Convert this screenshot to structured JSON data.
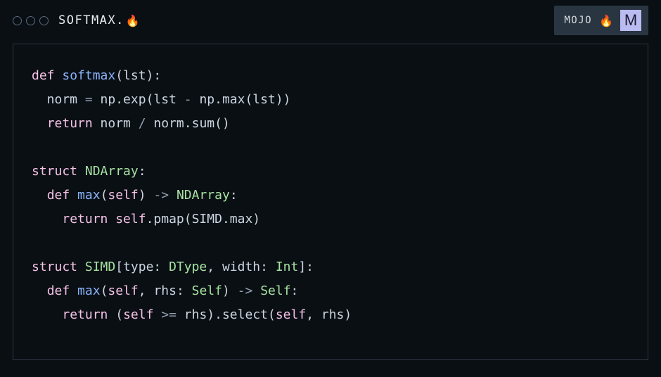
{
  "titlebar": {
    "filename_base": "SOFTMAX.",
    "fire_icon": "🔥",
    "lang_label": "MOJO",
    "lang_icon_letter": "M"
  },
  "code": {
    "lines": [
      [
        {
          "cls": "tok-kw",
          "t": "def "
        },
        {
          "cls": "tok-fn",
          "t": "softmax"
        },
        {
          "cls": "tok-paren",
          "t": "(lst):"
        }
      ],
      [
        {
          "cls": "tok-text",
          "t": "  norm "
        },
        {
          "cls": "tok-op",
          "t": "= "
        },
        {
          "cls": "tok-text",
          "t": "np.exp(lst "
        },
        {
          "cls": "tok-op",
          "t": "- "
        },
        {
          "cls": "tok-text",
          "t": "np.max(lst))"
        }
      ],
      [
        {
          "cls": "tok-text",
          "t": "  "
        },
        {
          "cls": "tok-kw",
          "t": "return "
        },
        {
          "cls": "tok-text",
          "t": "norm "
        },
        {
          "cls": "tok-op",
          "t": "/ "
        },
        {
          "cls": "tok-text",
          "t": "norm.sum()"
        }
      ],
      [],
      [
        {
          "cls": "tok-kw",
          "t": "struct "
        },
        {
          "cls": "tok-type",
          "t": "NDArray"
        },
        {
          "cls": "tok-paren",
          "t": ":"
        }
      ],
      [
        {
          "cls": "tok-text",
          "t": "  "
        },
        {
          "cls": "tok-kw",
          "t": "def "
        },
        {
          "cls": "tok-fn",
          "t": "max"
        },
        {
          "cls": "tok-paren",
          "t": "("
        },
        {
          "cls": "tok-kw",
          "t": "self"
        },
        {
          "cls": "tok-paren",
          "t": ") "
        },
        {
          "cls": "tok-op",
          "t": "-> "
        },
        {
          "cls": "tok-type",
          "t": "NDArray"
        },
        {
          "cls": "tok-paren",
          "t": ":"
        }
      ],
      [
        {
          "cls": "tok-text",
          "t": "    "
        },
        {
          "cls": "tok-kw",
          "t": "return "
        },
        {
          "cls": "tok-kw",
          "t": "self"
        },
        {
          "cls": "tok-text",
          "t": ".pmap(SIMD.max)"
        }
      ],
      [],
      [
        {
          "cls": "tok-kw",
          "t": "struct "
        },
        {
          "cls": "tok-type",
          "t": "SIMD"
        },
        {
          "cls": "tok-paren",
          "t": "[type: "
        },
        {
          "cls": "tok-type",
          "t": "DType"
        },
        {
          "cls": "tok-paren",
          "t": ", width: "
        },
        {
          "cls": "tok-type",
          "t": "Int"
        },
        {
          "cls": "tok-paren",
          "t": "]:"
        }
      ],
      [
        {
          "cls": "tok-text",
          "t": "  "
        },
        {
          "cls": "tok-kw",
          "t": "def "
        },
        {
          "cls": "tok-fn",
          "t": "max"
        },
        {
          "cls": "tok-paren",
          "t": "("
        },
        {
          "cls": "tok-kw",
          "t": "self"
        },
        {
          "cls": "tok-paren",
          "t": ", rhs: "
        },
        {
          "cls": "tok-type",
          "t": "Self"
        },
        {
          "cls": "tok-paren",
          "t": ") "
        },
        {
          "cls": "tok-op",
          "t": "-> "
        },
        {
          "cls": "tok-type",
          "t": "Self"
        },
        {
          "cls": "tok-paren",
          "t": ":"
        }
      ],
      [
        {
          "cls": "tok-text",
          "t": "    "
        },
        {
          "cls": "tok-kw",
          "t": "return "
        },
        {
          "cls": "tok-paren",
          "t": "("
        },
        {
          "cls": "tok-kw",
          "t": "self"
        },
        {
          "cls": "tok-text",
          "t": " "
        },
        {
          "cls": "tok-op",
          "t": ">= "
        },
        {
          "cls": "tok-text",
          "t": "rhs).select("
        },
        {
          "cls": "tok-kw",
          "t": "self"
        },
        {
          "cls": "tok-text",
          "t": ", rhs)"
        }
      ]
    ]
  }
}
